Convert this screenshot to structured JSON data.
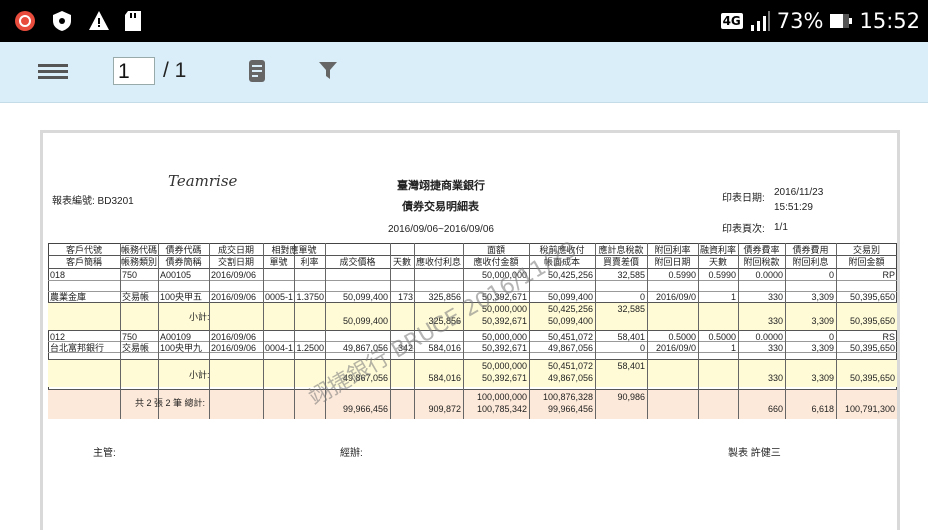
{
  "status_bar": {
    "network": "4G",
    "battery": "73%",
    "time": "15:52",
    "icons": [
      "app-notification-icon",
      "shield-icon",
      "warning-icon",
      "sd-card-icon",
      "signal-icon",
      "battery-icon"
    ]
  },
  "toolbar": {
    "menu_icon": "hamburger-menu-icon",
    "page_value": "1",
    "page_total": "/ 1",
    "doc_icon": "document-icon",
    "filter_icon": "filter-icon"
  },
  "report": {
    "logo_text": "Teamrise",
    "bank_name": "臺灣翊捷商業銀行",
    "title": "債券交易明細表",
    "date_range": "2016/09/06~2016/09/06",
    "report_no": "報表編號: BD3201",
    "print_date_label": "印表日期:",
    "print_date": "2016/11/23",
    "print_time": "15:51:29",
    "print_page_label": "印表頁次:",
    "print_page": "1/1",
    "header_row1": [
      "客戶代號",
      "帳務代碼",
      "債券代碼",
      "成交日期",
      "相對應單號",
      "",
      "",
      "面額",
      "稅前應收付",
      "應計息稅款",
      "附回利率",
      "融資利率",
      "債券費率",
      "債券費用",
      "交易別"
    ],
    "header_row2": [
      "客戶簡稱",
      "帳務類別",
      "債券簡稱",
      "交割日期",
      "單號",
      "利率",
      "成交價格",
      "天數",
      "應收付利息",
      "應收付金額",
      "帳面成本",
      "買賣差價",
      "附回日期",
      "天數",
      "附回稅款",
      "附回利息",
      "附回金額"
    ],
    "rows": [
      [
        "018",
        "750",
        "A00105",
        "2016/09/06",
        "",
        "",
        "",
        "",
        "",
        "50,000,000",
        "50,425,256",
        "32,585",
        "0.5990",
        "0.5990",
        "0.0000",
        "0",
        "RP"
      ],
      [
        "農業金庫",
        "交易帳",
        "100央甲五",
        "2016/09/06",
        "0005-1",
        "1.3750",
        "50,099,400",
        "173",
        "325,856",
        "50,392,671",
        "50,099,400",
        "0",
        "2016/09/0",
        "1",
        "330",
        "3,309",
        "50,395,650"
      ],
      [
        "012",
        "750",
        "A00109",
        "2016/09/06",
        "",
        "",
        "",
        "",
        "",
        "50,000,000",
        "50,451,072",
        "58,401",
        "0.5000",
        "0.5000",
        "0.0000",
        "0",
        "RS"
      ],
      [
        "台北富邦銀行",
        "交易帳",
        "100央甲九",
        "2016/09/06",
        "0004-1",
        "1.2500",
        "49,867,056",
        "342",
        "584,016",
        "50,392,671",
        "49,867,056",
        "0",
        "2016/09/0",
        "1",
        "330",
        "3,309",
        "50,395,650"
      ]
    ],
    "subtotal_label": "小計:",
    "subtotals": [
      {
        "price": "50,099,400",
        "interest": "325,856",
        "face": "50,000,000",
        "amount": "50,392,671",
        "pretax": "50,425,256",
        "cost": "50,099,400",
        "tax": "32,585",
        "fee_rate": "330",
        "fee": "3,309",
        "total": "50,395,650"
      },
      {
        "price": "49,867,056",
        "interest": "584,016",
        "face": "50,000,000",
        "amount": "50,392,671",
        "pretax": "50,451,072",
        "cost": "49,867,056",
        "tax": "58,401",
        "fee_rate": "330",
        "fee": "3,309",
        "total": "50,395,650"
      }
    ],
    "grand_label": "共 2 張 2 筆 總計:",
    "grand": {
      "price": "99,966,456",
      "interest": "909,872",
      "face": "100,000,000",
      "amount": "100,785,342",
      "pretax": "100,876,328",
      "cost": "99,966,456",
      "tax": "90,986",
      "fee_rate": "660",
      "fee": "6,618",
      "total": "100,791,300"
    },
    "sign_manager": "主管:",
    "sign_handler": "經辦:",
    "sign_maker": "製表 許健三",
    "watermark": "翊捷銀行 BRUCE 2016/11/23"
  }
}
